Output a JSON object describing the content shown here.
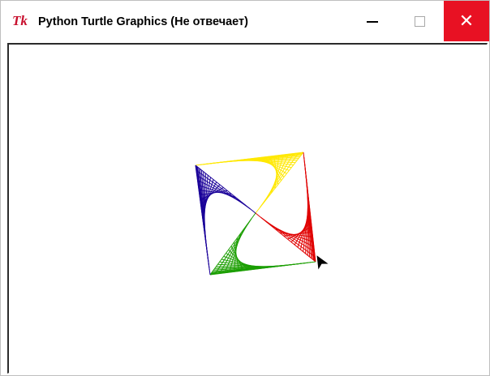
{
  "window": {
    "app_icon": "Tk",
    "title": "Python Turtle Graphics (Не отвечает)"
  },
  "controls": {
    "minimize_icon": "minimize-icon",
    "maximize_icon": "maximize-icon",
    "close_icon": "close-icon",
    "close_bg": "#e81123",
    "close_glyph": "✕"
  },
  "canvas": {
    "background": "#ffffff",
    "turtle_color": "#000000",
    "pattern_colors": [
      "#ffe800",
      "#e00000",
      "#1a9e00",
      "#1a0099"
    ]
  }
}
